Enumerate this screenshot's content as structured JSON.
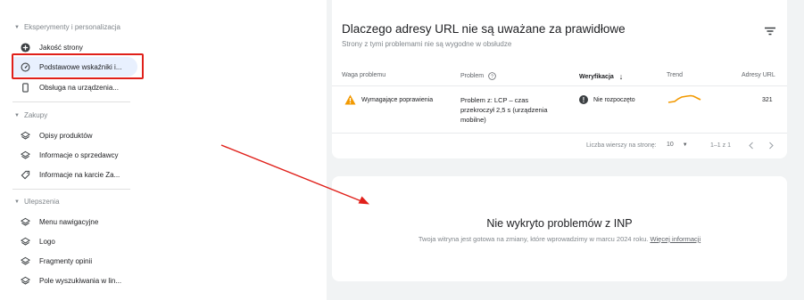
{
  "sidebar": {
    "sections": [
      {
        "label": "Eksperymenty i personalizacja"
      },
      {
        "label": "Zakupy"
      },
      {
        "label": "Ulepszenia"
      }
    ],
    "items": [
      {
        "label": "Jakość strony"
      },
      {
        "label": "Podstawowe wskaźniki i..."
      },
      {
        "label": "Obsługa na urządzenia..."
      },
      {
        "label": "Opisy produktów"
      },
      {
        "label": "Informacje o sprzedawcy"
      },
      {
        "label": "Informacje na karcie Za..."
      },
      {
        "label": "Menu nawigacyjne"
      },
      {
        "label": "Logo"
      },
      {
        "label": "Fragmenty opinii"
      },
      {
        "label": "Pole wyszukiwania w lin..."
      }
    ],
    "active_index": 1
  },
  "issues_card": {
    "title": "Dlaczego adresy URL nie są uważane za prawidłowe",
    "subtitle": "Strony z tymi problemami nie są wygodne w obsłudze",
    "columns": {
      "severity": "Waga problemu",
      "problem": "Problem",
      "validation": "Weryfikacja",
      "trend": "Trend",
      "urls": "Adresy URL"
    },
    "rows": [
      {
        "severity": "Wymagające poprawienia",
        "problem_line1": "Problem z: LCP – czas",
        "problem_line2": "przekroczył 2,5 s (urządzenia",
        "problem_line3": "mobilne)",
        "validation": "Nie rozpoczęto",
        "urls": "321"
      }
    ],
    "pagination": {
      "rows_per_page_label": "Liczba wierszy na stronę:",
      "rows_per_page": "10",
      "range": "1–1 z 1"
    }
  },
  "inp_card": {
    "title": "Nie wykryto problemów z INP",
    "description": "Twoja witryna jest gotowa na zmiany, które wprowadzimy w marcu 2024 roku.",
    "link": "Więcej informacji"
  },
  "colors": {
    "annotation_red": "#e0201a",
    "warning_orange": "#f29900",
    "active_bg": "#e8f0fe",
    "trend_line": "#f29900"
  }
}
